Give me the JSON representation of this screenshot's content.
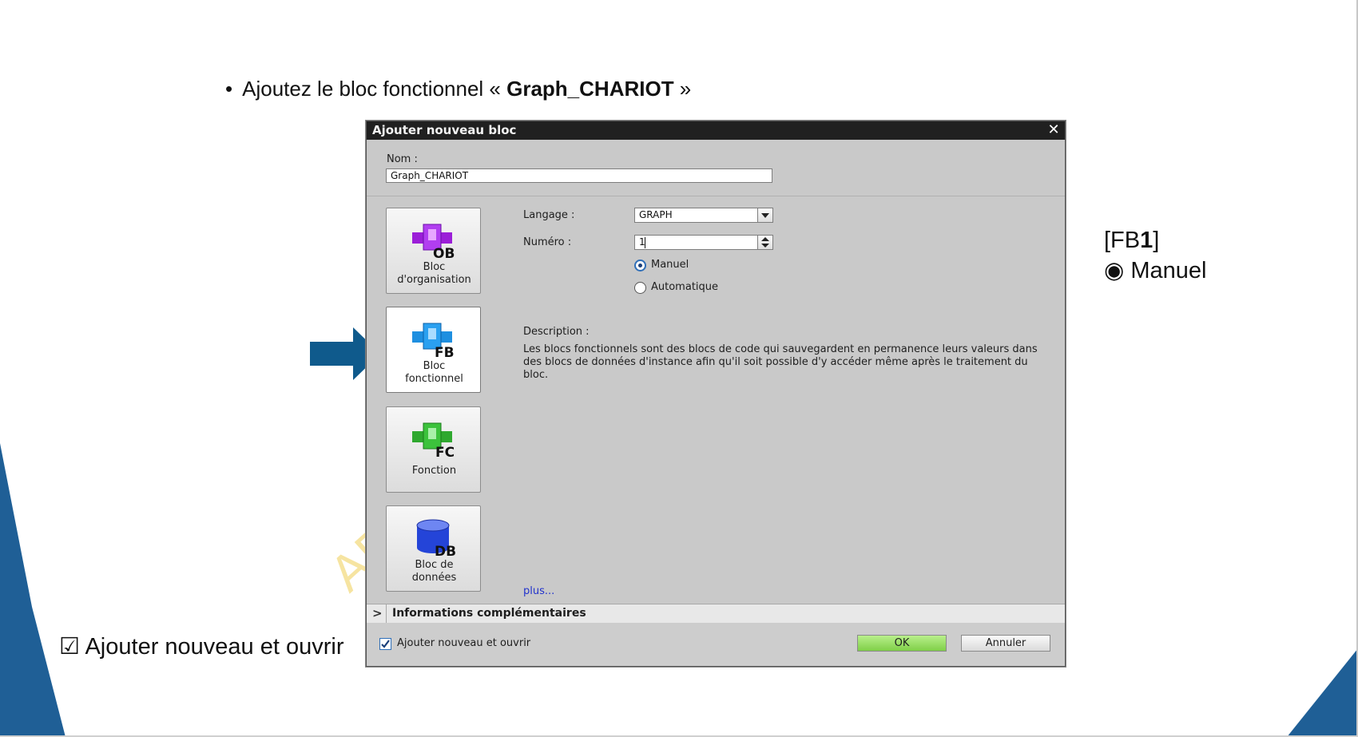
{
  "slide": {
    "bullet_dot": "•",
    "bullet_text": "Ajoutez le bloc fonctionnel « ",
    "bullet_bold": "Graph_CHARIOT",
    "bullet_end": " »",
    "note_right_open": "[FB",
    "note_right_bold": "1",
    "note_right_close": "]",
    "note_radio_symbol": "◉",
    "note_radio_text": "Manuel",
    "note_left_symbol": "☑",
    "note_left_text": "Ajouter nouveau et ouvrir",
    "watermark": "AP",
    "colors": {
      "accent_blue": "#1f5f96",
      "arrow": "#0f5a8c"
    }
  },
  "dialog": {
    "title": "Ajouter nouveau bloc",
    "close_symbol": "✕",
    "name_label": "Nom :",
    "name_value": "Graph_CHARIOT",
    "block_types": [
      {
        "code": "OB",
        "label_line1": "Bloc",
        "label_line2": "d'organisation",
        "color": "#9b1ed8",
        "selected": false
      },
      {
        "code": "FB",
        "label_line1": "Bloc",
        "label_line2": "fonctionnel",
        "color": "#1e8fe0",
        "selected": true
      },
      {
        "code": "FC",
        "label_line1": "Fonction",
        "label_line2": "",
        "color": "#2fa82f",
        "selected": false
      },
      {
        "code": "DB",
        "label_line1": "Bloc de",
        "label_line2": "données",
        "color": "#2444d8",
        "selected": false
      }
    ],
    "language_label": "Langage :",
    "language_value": "GRAPH",
    "number_label": "Numéro :",
    "number_value": "1",
    "radio_options": [
      {
        "label": "Manuel",
        "checked": true
      },
      {
        "label": "Automatique",
        "checked": false
      }
    ],
    "description_label": "Description :",
    "description_text": "Les blocs fonctionnels sont des blocs de code qui sauvegardent en permanence leurs valeurs dans des blocs de données d'instance afin qu'il soit possible d'y accéder même après le traitement du bloc.",
    "more_link": "plus...",
    "info_chevron": ">",
    "info_section": "Informations complémentaires",
    "add_open_label": "Ajouter nouveau et ouvrir",
    "add_open_checked": true,
    "ok_label": "OK",
    "cancel_label": "Annuler"
  }
}
